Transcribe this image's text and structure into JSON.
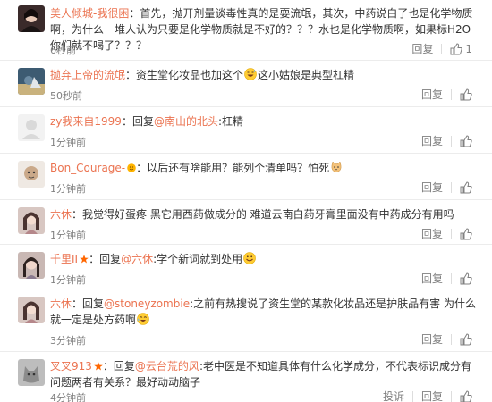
{
  "comments": [
    {
      "user": "美人倾城-我很困",
      "text": "：首先，抛开剂量谈毒性真的是耍流氓，其次，中药说白了也是化学物质啊，为什么一堆人认为只要是化学物质就是不好的？？？水也是化学物质啊，如果标H2O你们就不喝了？？？",
      "time": "6秒前",
      "reply": "回复",
      "likes": "1"
    },
    {
      "user": "抛弃上帝的流氓",
      "text": "：资生堂化妆品也加这个",
      "emoji": "grinning-sweat",
      "text2": "这小姑娘是典型杠精",
      "time": "50秒前",
      "reply": "回复"
    },
    {
      "user": "zy我来自1999",
      "text_prefix": "：回复",
      "mention": "@南山的北头",
      "text": ":杠精",
      "time": "1分钟前",
      "reply": "回复"
    },
    {
      "user": "Bon_Courage-",
      "badge": "vip-smile",
      "text": "：以后还有啥能用？能列个清单吗？怕死",
      "emoji": "cat-face",
      "time": "1分钟前",
      "reply": "回复"
    },
    {
      "user": "六休",
      "text": "：我觉得好蛋疼 黑它用西药做成分的 难道云南白药牙膏里面没有中药成分有用吗",
      "time": "1分钟前",
      "reply": "回复"
    },
    {
      "user": "千里II",
      "badge": "star",
      "text_prefix": "：回复",
      "mention": "@六休",
      "text": ":学个新词就到处用",
      "emoji": "grin",
      "time": "1分钟前",
      "reply": "回复"
    },
    {
      "user": "六休",
      "text_prefix": "：回复",
      "mention": "@stoneyzombie",
      "text": ":之前有热搜说了资生堂的某款化妆品还是护肤品有害 为什么就一定是处方药啊",
      "emoji": "cry-laugh",
      "time": "3分钟前",
      "reply": "回复"
    },
    {
      "user": "叉叉913",
      "badge": "star",
      "text_prefix": "：回复",
      "mention": "@云台荒的风",
      "text": ":老中医是不知道具体有什么化学成分，不代表标识成分有问题两者有关系？最好动动脑子",
      "time": "4分钟前",
      "report": "投诉",
      "reply": "回复"
    }
  ],
  "colors": {
    "username": "#eb7350",
    "text": "#333333",
    "meta": "#808080",
    "divider": "#ececec"
  }
}
